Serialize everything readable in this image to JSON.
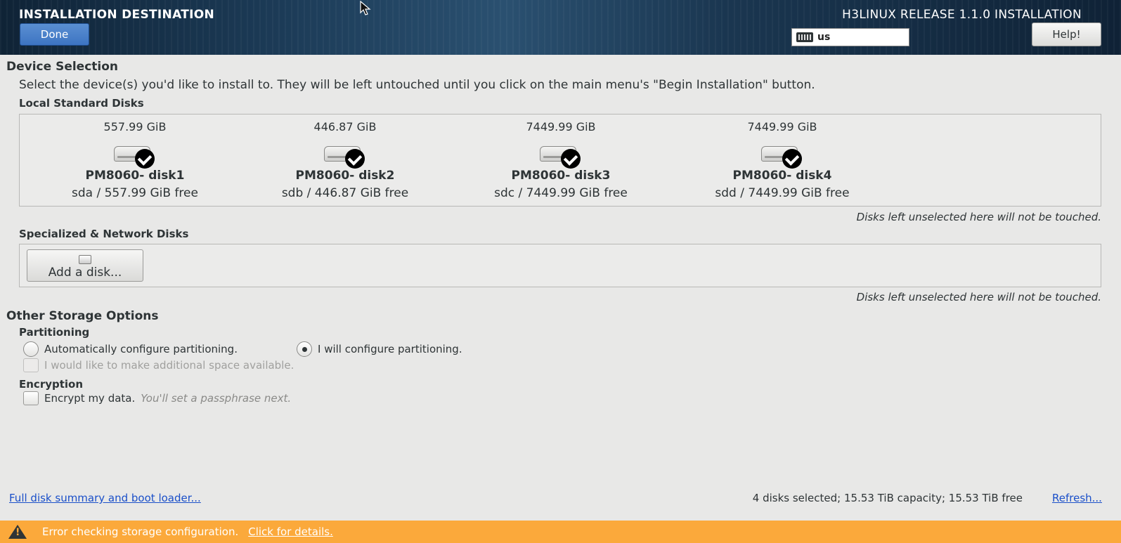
{
  "header": {
    "title": "INSTALLATION DESTINATION",
    "done_label": "Done",
    "release": "H3LINUX RELEASE 1.1.0 INSTALLATION",
    "keyboard_layout": "us",
    "help_label": "Help!"
  },
  "device_selection": {
    "heading": "Device Selection",
    "intro": "Select the device(s) you'd like to install to.  They will be left untouched until you click on the main menu's \"Begin Installation\" button.",
    "local_heading": "Local Standard Disks",
    "disks": [
      {
        "size": "557.99 GiB",
        "name": "PM8060- disk1",
        "free": "sda  /  557.99 GiB free",
        "selected": true
      },
      {
        "size": "446.87 GiB",
        "name": "PM8060- disk2",
        "free": "sdb  /  446.87 GiB free",
        "selected": true
      },
      {
        "size": "7449.99 GiB",
        "name": "PM8060- disk3",
        "free": "sdc  /  7449.99 GiB free",
        "selected": true
      },
      {
        "size": "7449.99 GiB",
        "name": "PM8060- disk4",
        "free": "sdd  /  7449.99 GiB free",
        "selected": true
      }
    ],
    "untouched_note": "Disks left unselected here will not be touched.",
    "network_heading": "Specialized & Network Disks",
    "add_disk_label": "Add a disk...",
    "network_note": "Disks left unselected here will not be touched."
  },
  "storage_options": {
    "heading": "Other Storage Options",
    "partitioning_heading": "Partitioning",
    "auto_label": "Automatically configure partitioning.",
    "manual_label": "I will configure partitioning.",
    "selected": "manual",
    "extra_space_label": "I would like to make additional space available.",
    "encryption_heading": "Encryption",
    "encrypt_label": "Encrypt my data.",
    "encrypt_hint": "You'll set a passphrase next."
  },
  "footer": {
    "summary_link": "Full disk summary and boot loader...",
    "status": "4 disks selected; 15.53 TiB capacity; 15.53 TiB free",
    "refresh_link": "Refresh..."
  },
  "error_bar": {
    "message": "Error checking storage configuration.",
    "details_link": "Click for details.",
    "color": "#fba93b"
  }
}
